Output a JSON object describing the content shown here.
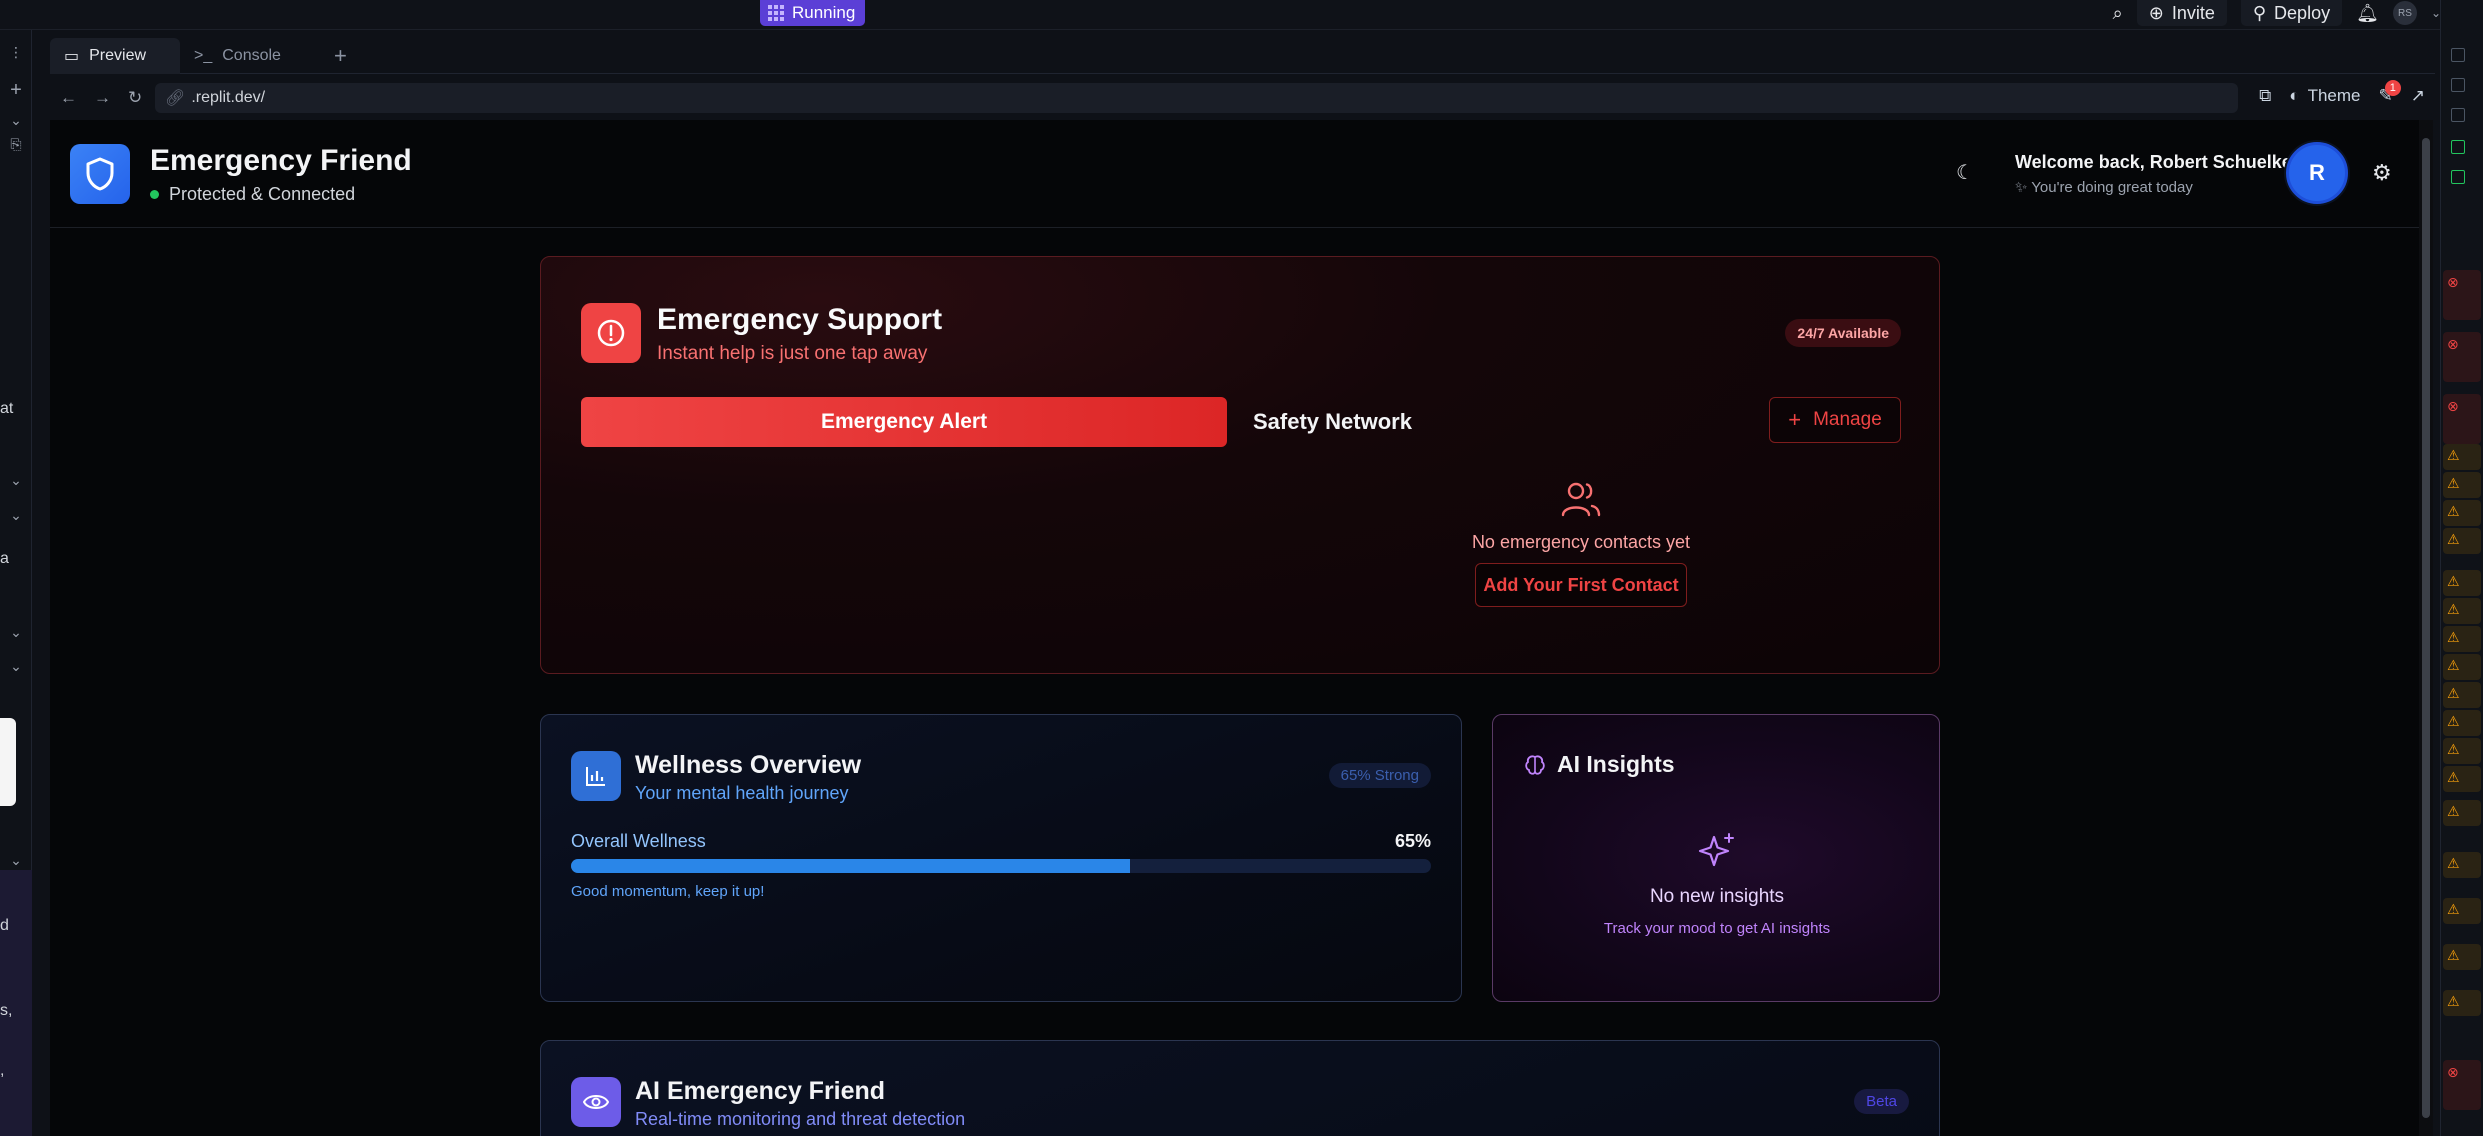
{
  "workspace": {
    "running_label": "Running",
    "invite_label": "Invite",
    "deploy_label": "Deploy",
    "user_initials": "RS"
  },
  "tabs": [
    {
      "label": "Preview"
    },
    {
      "label": "Console"
    }
  ],
  "urlbar": {
    "url": ".replit.dev/",
    "theme_label": "Theme",
    "notif_count": "1"
  },
  "left_rail_text": [
    "at",
    "a",
    "d",
    "s,",
    ","
  ],
  "app": {
    "brand": "Emergency Friend",
    "status": "Protected & Connected",
    "welcome": "Welcome back, Robert Schuelke",
    "welcome_sub": "You're doing great today",
    "avatar_initial": "R"
  },
  "emergency": {
    "title": "Emergency Support",
    "subtitle": "Instant help is just one tap away",
    "badge": "24/7 Available",
    "alert_button": "Emergency Alert",
    "safety_tab": "Safety Network",
    "manage_button": "Manage",
    "empty_text": "No emergency contacts yet",
    "add_first_button": "Add Your First Contact"
  },
  "wellness": {
    "title": "Wellness Overview",
    "subtitle": "Your mental health journey",
    "badge": "65% Strong",
    "overall_label": "Overall Wellness",
    "overall_value": "65%",
    "progress": 0.65,
    "note": "Good momentum, keep it up!"
  },
  "ai_insights": {
    "title": "AI Insights",
    "empty_title": "No new insights",
    "empty_sub": "Track your mood to get AI insights"
  },
  "ai_friend": {
    "title": "AI Emergency Friend",
    "subtitle": "Real-time monitoring and threat detection",
    "badge": "Beta"
  },
  "colors": {
    "accent_red": "#ef4444",
    "accent_blue": "#2a86e8",
    "accent_purple": "#c084fc",
    "running": "#5b3fd6"
  }
}
